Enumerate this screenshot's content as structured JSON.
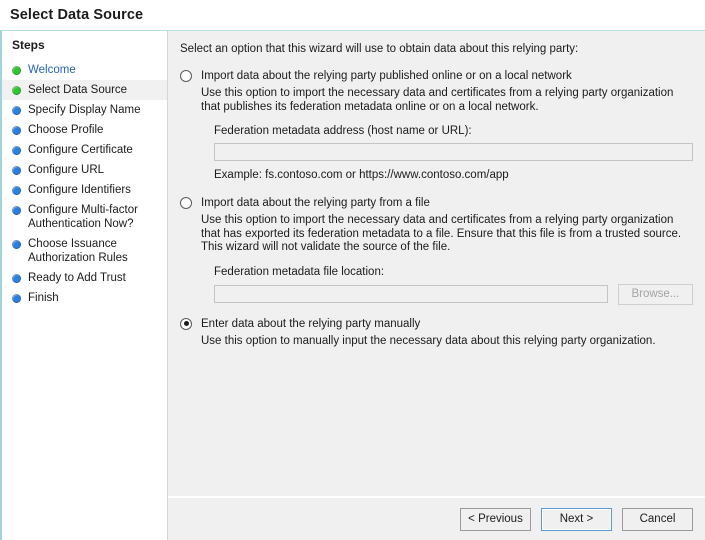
{
  "header": {
    "title": "Select Data Source",
    "accent_color": "#9fd4dd"
  },
  "sidebar": {
    "heading": "Steps",
    "colors": {
      "done": "#2fc62f",
      "pending": "#2b7fe0",
      "link": "#2763b8"
    },
    "items": [
      {
        "label": "Welcome",
        "state": "done",
        "current": false,
        "link": true
      },
      {
        "label": "Select Data Source",
        "state": "done",
        "current": true,
        "link": false
      },
      {
        "label": "Specify Display Name",
        "state": "pending",
        "current": false,
        "link": false
      },
      {
        "label": "Choose Profile",
        "state": "pending",
        "current": false,
        "link": false
      },
      {
        "label": "Configure Certificate",
        "state": "pending",
        "current": false,
        "link": false
      },
      {
        "label": "Configure URL",
        "state": "pending",
        "current": false,
        "link": false
      },
      {
        "label": "Configure Identifiers",
        "state": "pending",
        "current": false,
        "link": false
      },
      {
        "label": "Configure Multi-factor Authentication Now?",
        "state": "pending",
        "current": false,
        "link": false
      },
      {
        "label": "Choose Issuance Authorization Rules",
        "state": "pending",
        "current": false,
        "link": false
      },
      {
        "label": "Ready to Add Trust",
        "state": "pending",
        "current": false,
        "link": false
      },
      {
        "label": "Finish",
        "state": "pending",
        "current": false,
        "link": false
      }
    ]
  },
  "main": {
    "intro": "Select an option that this wizard will use to obtain data about this relying party:",
    "options": [
      {
        "title": "Import data about the relying party published online or on a local network",
        "description": "Use this option to import the necessary data and certificates from a relying party organization that publishes its federation metadata online or on a local network.",
        "selected": false,
        "field_label": "Federation metadata address (host name or URL):",
        "field_value": "",
        "field_placeholder": "",
        "example": "Example: fs.contoso.com or https://www.contoso.com/app"
      },
      {
        "title": "Import data about the relying party from a file",
        "description": "Use this option to import the necessary data and certificates from a relying party organization that has exported its federation metadata to a file. Ensure that this file is from a trusted source.  This wizard will not validate the source of the file.",
        "selected": false,
        "field_label": "Federation metadata file location:",
        "field_value": "",
        "field_placeholder": "",
        "browse_label": "Browse...",
        "browse_disabled": true
      },
      {
        "title": "Enter data about the relying party manually",
        "description": "Use this option to manually input the necessary data about this relying party organization.",
        "selected": true
      }
    ]
  },
  "footer": {
    "previous_label": "< Previous",
    "next_label": "Next >",
    "cancel_label": "Cancel"
  }
}
